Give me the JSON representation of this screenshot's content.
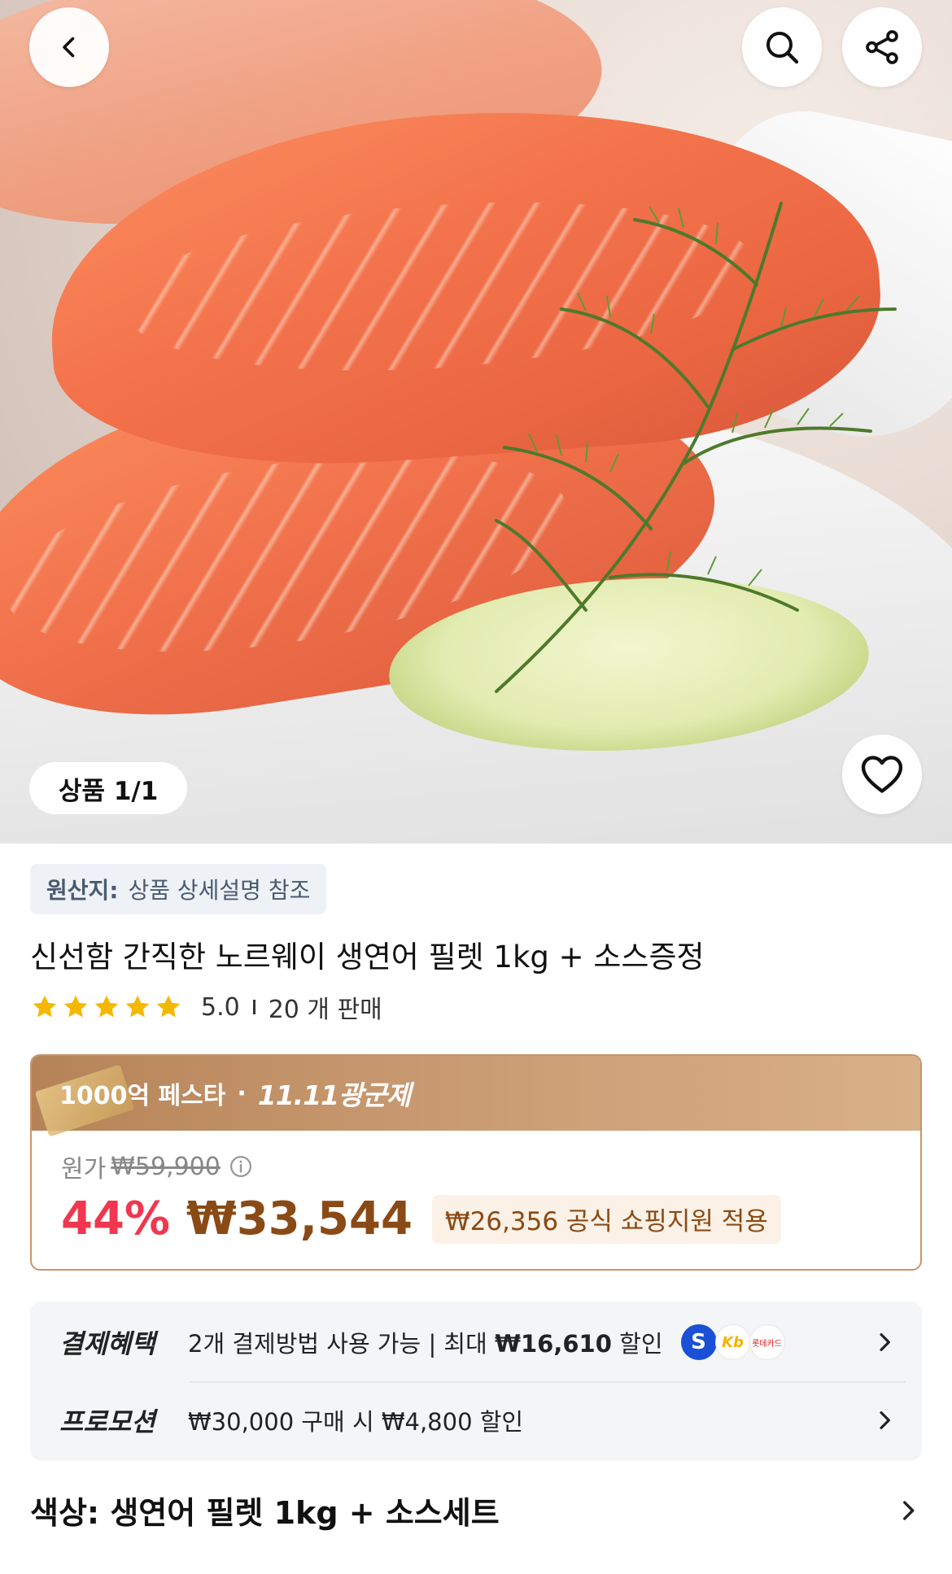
{
  "hero": {
    "image_counter": "상품 1/1"
  },
  "header": {
    "back_icon": "chevron-left-icon",
    "search_icon": "search-icon",
    "share_icon": "share-icon",
    "wishlist_icon": "heart-icon"
  },
  "product": {
    "origin_label": "원산지:",
    "origin_value": "상품 상세설명 참조",
    "title": "신선함 간직한 노르웨이 생연어 필렛 1kg + 소스증정",
    "rating": "5.0",
    "sold": "20 개 판매",
    "stars": 5
  },
  "festival": {
    "name": "1000억 페스타",
    "dot": "·",
    "event": "11.11광군제",
    "original_label": "원가",
    "original_price": "₩59,900",
    "discount": "44%",
    "price": "₩33,544",
    "support_text": "₩26,356 공식 쇼핑지원 적용"
  },
  "benefits": {
    "payment_key": "결제혜택",
    "payment_prefix": "2개 결제방법 사용 가능 | 최대 ",
    "payment_amount": "₩16,610",
    "payment_suffix": " 할인",
    "card_shinhan": "S",
    "card_kb": "Kb",
    "card_lotte": "롯데카드",
    "promo_key": "프로모션",
    "promo_text": "₩30,000 구매 시 ₩4,800 할인"
  },
  "option": {
    "label": "색상: 생연어 필렛 1kg + 소스세트"
  },
  "colors": {
    "discount_red": "#f0374f",
    "price_brown": "#8a4a15",
    "star_yellow": "#f5b800",
    "fest_border": "#c9946a"
  }
}
